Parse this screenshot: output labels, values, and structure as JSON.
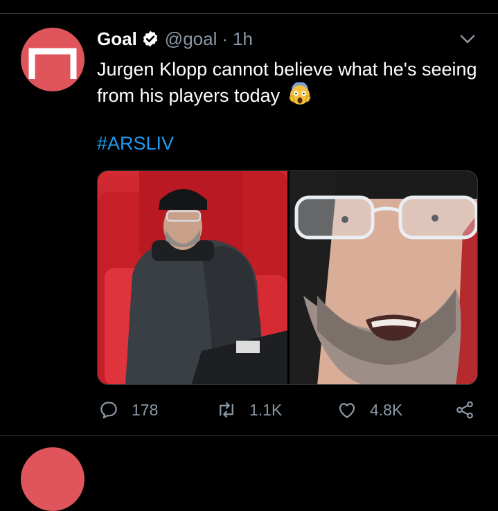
{
  "tweet": {
    "author_name": "Goal",
    "handle": "@goal",
    "separator": "·",
    "time": "1h",
    "text": "Jurgen Klopp cannot believe what he's seeing from his players today",
    "hashtag": "#ARSLIV",
    "stats": {
      "replies": "178",
      "retweets": "1.1K",
      "likes": "4.8K"
    }
  },
  "icons": {
    "verified": "verified-badge-icon",
    "more": "chevron-down-icon",
    "reply": "reply-icon",
    "retweet": "retweet-icon",
    "like": "heart-icon",
    "share": "share-icon",
    "emoji": "face-screaming-in-fear-emoji"
  },
  "colors": {
    "background": "#000000",
    "avatar": "#e0555c",
    "link": "#1d9bf0",
    "muted": "#8b98a5"
  }
}
